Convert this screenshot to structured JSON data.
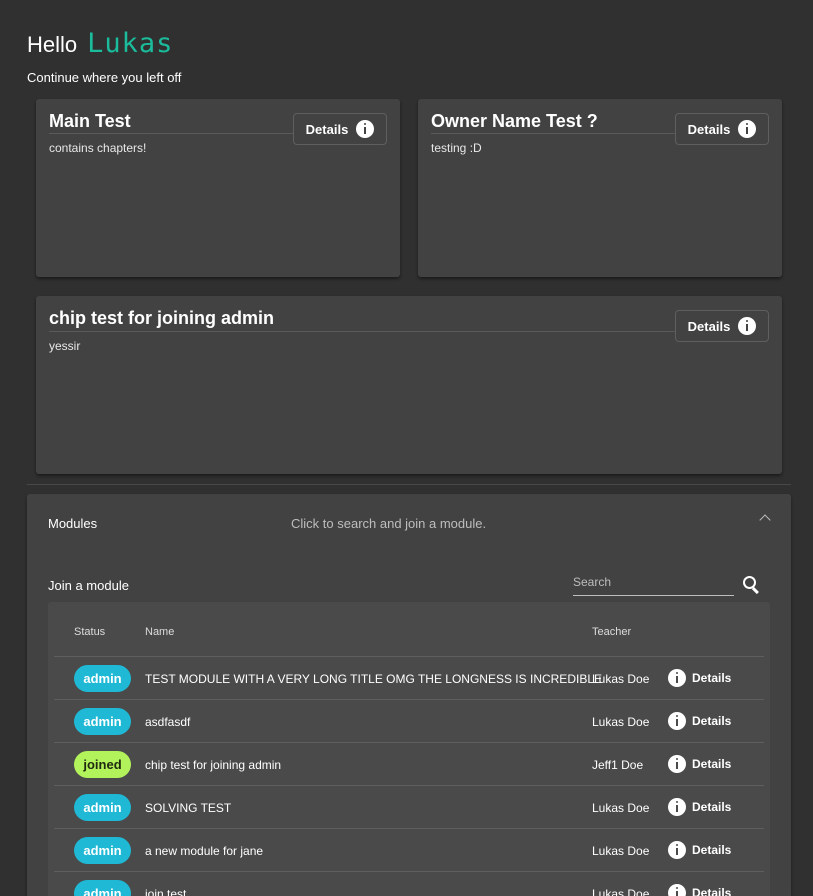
{
  "header": {
    "hello": "Hello",
    "user_name": "Lukas",
    "continue_text": "Continue where you left off"
  },
  "recent_cards": [
    {
      "title": "Main Test",
      "description": "contains chapters!",
      "details_label": "Details"
    },
    {
      "title": "Owner Name Test ?",
      "description": "testing :D",
      "details_label": "Details"
    },
    {
      "title": "chip test for joining admin",
      "description": "yessir",
      "details_label": "Details"
    }
  ],
  "modules_panel": {
    "title": "Modules",
    "description": "Click to search and join a module.",
    "join_label": "Join a module",
    "search_placeholder": "Search",
    "columns": {
      "status": "Status",
      "name": "Name",
      "teacher": "Teacher"
    },
    "rows": [
      {
        "status": "admin",
        "name": "TEST MODULE WITH A VERY LONG TITLE OMG THE LONGNESS IS INCREDIBLE",
        "teacher": "Lukas Doe",
        "details": "Details"
      },
      {
        "status": "admin",
        "name": "asdfasdf",
        "teacher": "Lukas Doe",
        "details": "Details"
      },
      {
        "status": "joined",
        "name": "chip test for joining admin",
        "teacher": "Jeff1 Doe",
        "details": "Details"
      },
      {
        "status": "admin",
        "name": "SOLVING TEST",
        "teacher": "Lukas Doe",
        "details": "Details"
      },
      {
        "status": "admin",
        "name": "a new module for jane",
        "teacher": "Lukas Doe",
        "details": "Details"
      },
      {
        "status": "admin",
        "name": "join test",
        "teacher": "Lukas Doe",
        "details": "Details"
      }
    ]
  },
  "colors": {
    "background": "#303030",
    "card": "#424242",
    "accent_name": "#1abc9c",
    "chip_admin": "#1fb9d6",
    "chip_joined": "#b2f25b"
  },
  "icons": {
    "details": "info-icon",
    "search": "search-icon",
    "collapse": "chevron-up-icon"
  }
}
